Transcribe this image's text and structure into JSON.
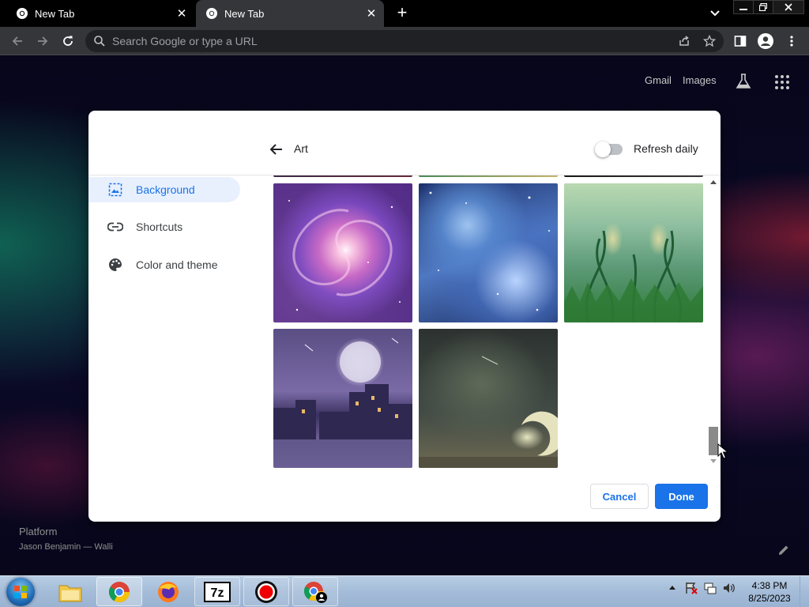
{
  "browser": {
    "tabs": [
      {
        "title": "New Tab",
        "active": false
      },
      {
        "title": "New Tab",
        "active": true
      }
    ],
    "omnibox": {
      "placeholder": "Search Google or type a URL"
    }
  },
  "ntp": {
    "links": {
      "gmail": "Gmail",
      "images": "Images"
    },
    "background_credit": {
      "title": "Platform",
      "author": "Jason Benjamin — Walli"
    }
  },
  "dialog": {
    "title": "Art",
    "refresh_daily": {
      "label": "Refresh daily",
      "enabled": false
    },
    "nav": [
      {
        "label": "Background",
        "icon": "image-icon",
        "active": true
      },
      {
        "label": "Shortcuts",
        "icon": "link-icon",
        "active": false
      },
      {
        "label": "Color and theme",
        "icon": "palette-icon",
        "active": false
      }
    ],
    "thumbnails": [
      "galaxy",
      "nebula",
      "plants",
      "city",
      "moon"
    ],
    "buttons": {
      "cancel": "Cancel",
      "done": "Done"
    }
  },
  "taskbar": {
    "apps": [
      "file-explorer",
      "chrome",
      "firefox",
      "7-zip",
      "recorder",
      "chrome-profile"
    ],
    "clock": {
      "time": "4:38 PM",
      "date": "8/25/2023"
    }
  },
  "colors": {
    "accent": "#1a73e8",
    "active_nav_bg": "#e8f0fe",
    "toolbar": "#35363a"
  }
}
